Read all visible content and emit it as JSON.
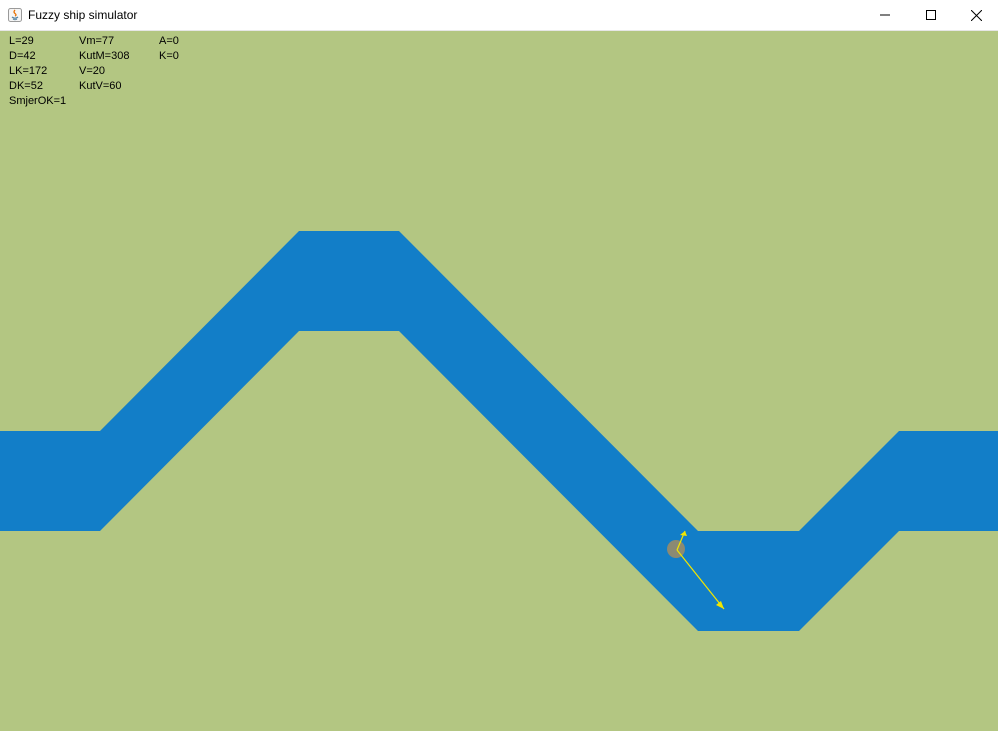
{
  "window": {
    "title": "Fuzzy ship simulator"
  },
  "titlebar": {
    "icons": [
      "java-app-icon",
      "minimize-icon",
      "maximize-icon",
      "close-icon"
    ]
  },
  "hud": {
    "col1": [
      "L=29",
      "D=42",
      "LK=172",
      "DK=52",
      "SmjerOK=1"
    ],
    "col2": [
      "Vm=77",
      "KutM=308",
      "V=20",
      "KutV=60"
    ],
    "col3": [
      "A=0",
      "K=0"
    ]
  },
  "colors": {
    "background": "#b3c682",
    "river": "#127ec8",
    "ship": "#8b8a73",
    "vector": "#f2e600",
    "text": "#000000"
  }
}
